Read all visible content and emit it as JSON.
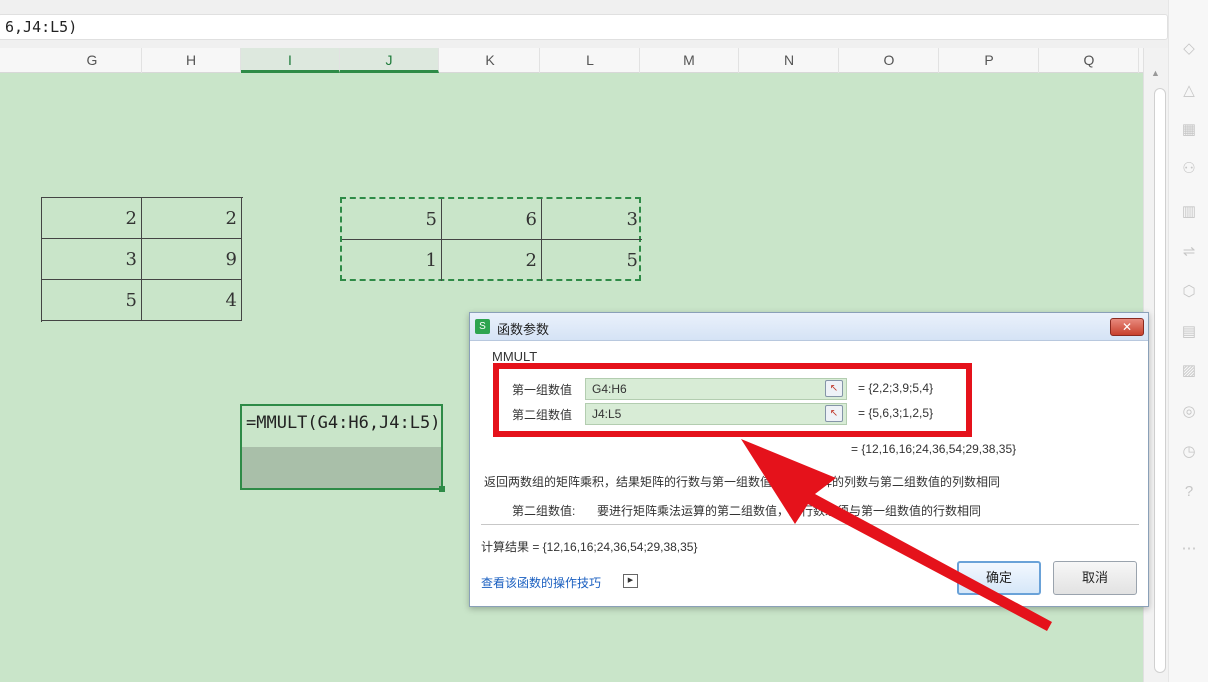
{
  "formula_bar": {
    "text": "6,J4:L5)"
  },
  "columns": [
    {
      "label": "G",
      "selected": false
    },
    {
      "label": "H",
      "selected": false
    },
    {
      "label": "I",
      "selected": true
    },
    {
      "label": "J",
      "selected": true
    },
    {
      "label": "K",
      "selected": false
    },
    {
      "label": "L",
      "selected": false
    },
    {
      "label": "M",
      "selected": false
    },
    {
      "label": "N",
      "selected": false
    },
    {
      "label": "O",
      "selected": false
    },
    {
      "label": "P",
      "selected": false
    },
    {
      "label": "Q",
      "selected": false
    }
  ],
  "matrix_a": [
    [
      "2",
      "2"
    ],
    [
      "3",
      "9"
    ],
    [
      "5",
      "4"
    ]
  ],
  "matrix_b": [
    [
      "5",
      "6",
      "3"
    ],
    [
      "1",
      "2",
      "5"
    ]
  ],
  "formula_cell": {
    "text": "=MMULT(G4:H6,J4:L5)"
  },
  "dialog": {
    "title": "函数参数",
    "function_name": "MMULT",
    "args": [
      {
        "label": "第一组数值",
        "value": "G4:H6",
        "preview": "= {2,2;3,9;5,4}"
      },
      {
        "label": "第二组数值",
        "value": "J4:L5",
        "preview": "= {5,6,3;1,2,5}"
      }
    ],
    "result_preview": "= {12,16,16;24,36,54;29,38,35}",
    "description": "返回两数组的矩阵乘积，结果矩阵的行数与第一组数值相同，矩阵的列数与第二组数值的列数相同",
    "arg_desc_label": "第二组数值:",
    "arg_desc_text": "要进行矩阵乘法运算的第二组数值，其行数必须与第一组数值的行数相同",
    "calc_result": "计算结果 = {12,16,16;24,36,54;29,38,35}",
    "help_link": "查看该函数的操作技巧",
    "ok_label": "确定",
    "cancel_label": "取消"
  },
  "colors": {
    "grid_bg": "#c9e5c9",
    "accent": "#2e8b47",
    "highlight": "#e5121b"
  },
  "icons": [
    "fill-icon",
    "shape-icon",
    "table-icon",
    "sort-icon",
    "chart-icon",
    "style-icon",
    "transform-icon",
    "card-icon",
    "image-icon",
    "compass-icon",
    "history-icon",
    "help-icon",
    "more-icon"
  ]
}
